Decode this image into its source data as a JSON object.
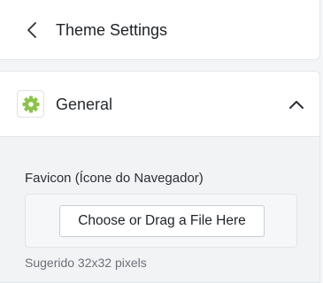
{
  "header": {
    "back_icon": "chevron-left-icon",
    "title": "Theme Settings"
  },
  "section": {
    "icon": "gear-icon",
    "icon_color": "#8bc34a",
    "title": "General",
    "toggle_icon": "chevron-up-icon",
    "expanded": true
  },
  "favicon": {
    "label": "Favicon (Ícone do Navegador)",
    "button_label": "Choose or Drag a File Here",
    "hint": "Sugerido 32x32 pixels"
  }
}
